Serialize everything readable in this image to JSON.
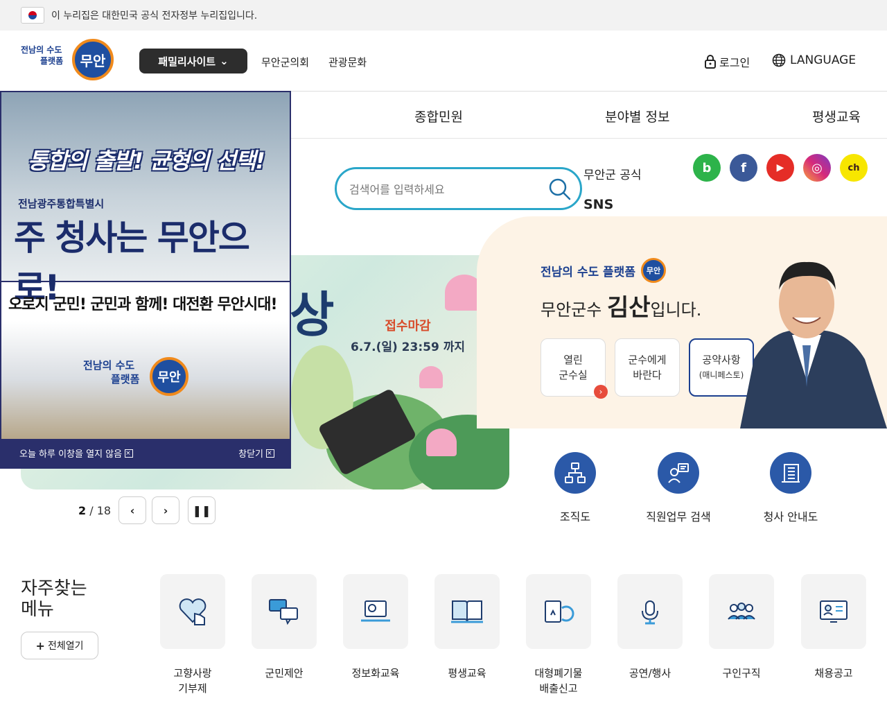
{
  "gov_banner": {
    "text": "이 누리집은 대한민국 공식 전자정부 누리집입니다."
  },
  "header": {
    "logo_line1": "전남의 수도",
    "logo_line2": "플랫폼",
    "logo_badge": "무안",
    "family_site": "패밀리사이트",
    "links": [
      "무안군의회",
      "관광문화"
    ],
    "login": "로그인",
    "language": "LANGUAGE"
  },
  "gnb": [
    "종합민원",
    "분야별 정보",
    "평생교육"
  ],
  "search": {
    "placeholder": "검색어를 입력하세요"
  },
  "sns": {
    "title_line1": "무안군 공식",
    "title_line2": "SNS",
    "buttons": [
      {
        "name": "blog",
        "label": "b",
        "color": "#2db34a"
      },
      {
        "name": "facebook",
        "label": "f",
        "color": "#3b5998"
      },
      {
        "name": "youtube",
        "label": "▶",
        "color": "#e52d27"
      },
      {
        "name": "instagram",
        "label": "◎",
        "color": "#d6297a"
      },
      {
        "name": "kakao",
        "label": "ch",
        "color": "#f7e600"
      }
    ]
  },
  "hero": {
    "big_text": "상",
    "deadline_label": "접수마감",
    "deadline_date": "6.7.(일) 23:59 까지"
  },
  "slider": {
    "current": "2",
    "total": "/ 18"
  },
  "mayor": {
    "logo": "전남의 수도 플랫폼",
    "logo_badge": "무안",
    "title_pre": "무안군수 ",
    "title_name": "김산",
    "title_post": "입니다.",
    "cards": [
      {
        "line1": "열린",
        "line2": "군수실"
      },
      {
        "line1": "군수에게",
        "line2": "바란다"
      },
      {
        "line1": "공약사항",
        "line2": "(매니페스토)"
      }
    ]
  },
  "quick_links": [
    "조직도",
    "직원업무 검색",
    "청사 안내도"
  ],
  "frequent": {
    "title_line1": "자주찾는",
    "title_line2": "메뉴",
    "open_all": "전체열기",
    "items": [
      {
        "line1": "고향사랑",
        "line2": "기부제"
      },
      {
        "line1": "군민제안",
        "line2": ""
      },
      {
        "line1": "정보화교육",
        "line2": ""
      },
      {
        "line1": "평생교육",
        "line2": ""
      },
      {
        "line1": "대형폐기물",
        "line2": "배출신고"
      },
      {
        "line1": "공연/행사",
        "line2": ""
      },
      {
        "line1": "구인구직",
        "line2": ""
      },
      {
        "line1": "채용공고",
        "line2": ""
      }
    ]
  },
  "popup": {
    "headline": "통합의 출발! 균형의 선택!",
    "sub": "전남광주통합특별시",
    "main": "주 청사는 무안으로!",
    "slogan": "오로지 군민! 군민과 함께! 대전환 무안시대!",
    "logo_line1": "전남의 수도",
    "logo_line2": "플랫폼",
    "logo_badge": "무안",
    "no_today": "오늘 하루 이창을 열지 않음",
    "close": "창닫기"
  }
}
